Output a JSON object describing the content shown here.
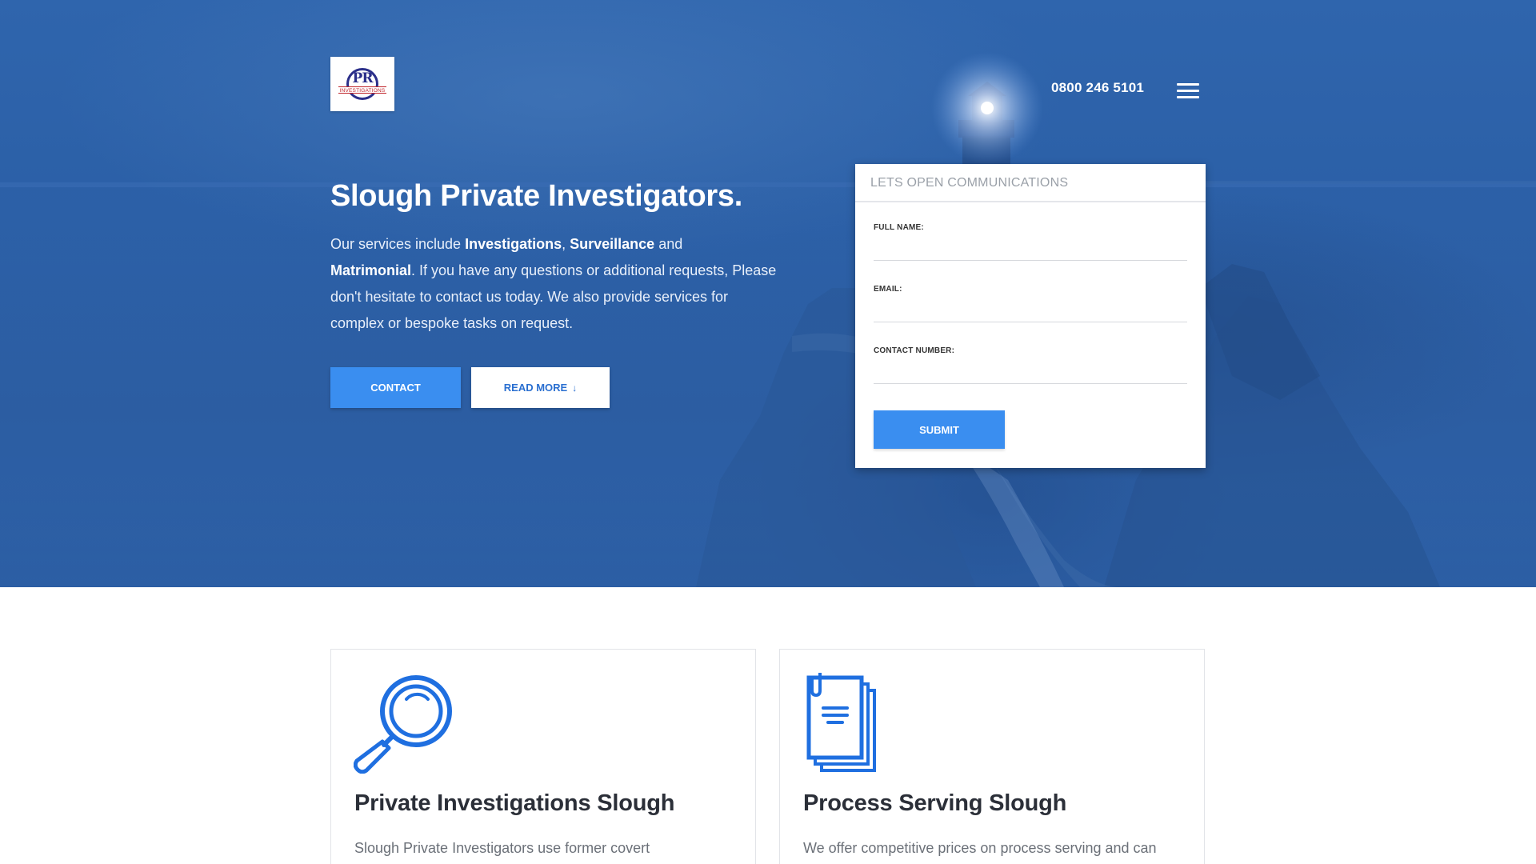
{
  "header": {
    "logo_text": "PR",
    "logo_subtext": "INVESTIGATIONS",
    "phone": "0800 246 5101"
  },
  "hero": {
    "title": "Slough Private Investigators.",
    "text": {
      "intro": "Our services include ",
      "service1": "Investigations",
      "comma": ", ",
      "service2": "Surveillance",
      "and": " and ",
      "service3": "Matrimonial",
      "rest": ". If you have any questions or additional requests, Please don't hesitate to contact us today. We also provide services for complex or bespoke tasks on request."
    },
    "contact_label": "CONTACT",
    "read_more_label": "READ MORE"
  },
  "form": {
    "header": "LETS OPEN COMMUNICATIONS",
    "full_name_label": "FULL NAME:",
    "email_label": "EMAIL:",
    "contact_number_label": "CONTACT NUMBER:",
    "full_name_value": "",
    "email_value": "",
    "contact_number_value": "",
    "submit_label": "SUBMIT"
  },
  "services": [
    {
      "icon": "magnifying-glass-icon",
      "title": "Private Investigations Slough",
      "text": "Slough Private Investigators use former covert"
    },
    {
      "icon": "documents-icon",
      "title": "Process Serving Slough",
      "text": "We offer competitive prices on process serving and can"
    }
  ],
  "colors": {
    "hero_blue": "#2c5fa6",
    "accent": "#3a8ef0",
    "icon_blue": "#1f6fe0"
  }
}
